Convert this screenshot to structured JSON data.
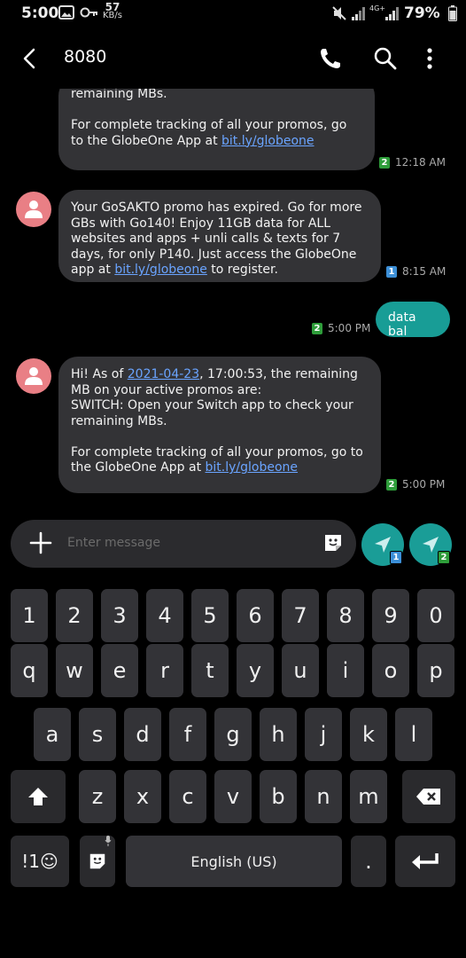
{
  "status_bar": {
    "time": "5:00",
    "network_speed": "57",
    "network_speed_unit": "KB/s",
    "battery": "79%",
    "network_type": "4G+",
    "icons": [
      "gallery-icon",
      "key-icon",
      "mute-icon",
      "signal-icon",
      "signal-icon",
      "battery-icon"
    ]
  },
  "header": {
    "title": "8080",
    "icons": [
      "back-icon",
      "phone-icon",
      "search-icon",
      "more-icon"
    ]
  },
  "messages": [
    {
      "direction": "incoming",
      "text_part1": "remaining MBs.\n\nFor complete tracking of all your promos, go to the GlobeOne App at ",
      "link": "bit.ly/globeone",
      "text_part2": "",
      "sim": "2",
      "time": "12:18 AM"
    },
    {
      "direction": "incoming",
      "text_part1": "Your GoSAKTO promo has expired. Go for more GBs with Go140! Enjoy 11GB data for ALL websites and apps + unli calls & texts for 7 days, for only P140. Just access the GlobeOne app at ",
      "link": "bit.ly/globeone",
      "text_part2": " to register.",
      "sim": "1",
      "time": "8:15 AM"
    },
    {
      "direction": "outgoing",
      "text": "data bal",
      "sim": "2",
      "time": "5:00 PM"
    },
    {
      "direction": "incoming",
      "text_part1": "Hi! As of ",
      "date_link": "2021-04-23",
      "text_part2": ", 17:00:53, the remaining MB on your active promos are:\nSWITCH: Open your Switch app to check your remaining MBs.\n\nFor complete tracking of all your promos, go to the GlobeOne App at ",
      "link": "bit.ly/globeone",
      "text_part3": "",
      "sim": "2",
      "time": "5:00 PM"
    }
  ],
  "composer": {
    "placeholder": "Enter message",
    "send_sim1": "1",
    "send_sim2": "2"
  },
  "keyboard": {
    "row_numbers": [
      "1",
      "2",
      "3",
      "4",
      "5",
      "6",
      "7",
      "8",
      "9",
      "0"
    ],
    "row_top": [
      "q",
      "w",
      "e",
      "r",
      "t",
      "y",
      "u",
      "i",
      "o",
      "p"
    ],
    "row_middle": [
      "a",
      "s",
      "d",
      "f",
      "g",
      "h",
      "j",
      "k",
      "l"
    ],
    "row_bottom": [
      "z",
      "x",
      "c",
      "v",
      "b",
      "n",
      "m"
    ],
    "symbols_key": "!1☺",
    "space_label": "English (US)",
    "period_key": "."
  },
  "colors": {
    "accent": "#189d96",
    "avatar": "#e97f85",
    "link": "#6aa4ff",
    "bubble": "#333336"
  }
}
